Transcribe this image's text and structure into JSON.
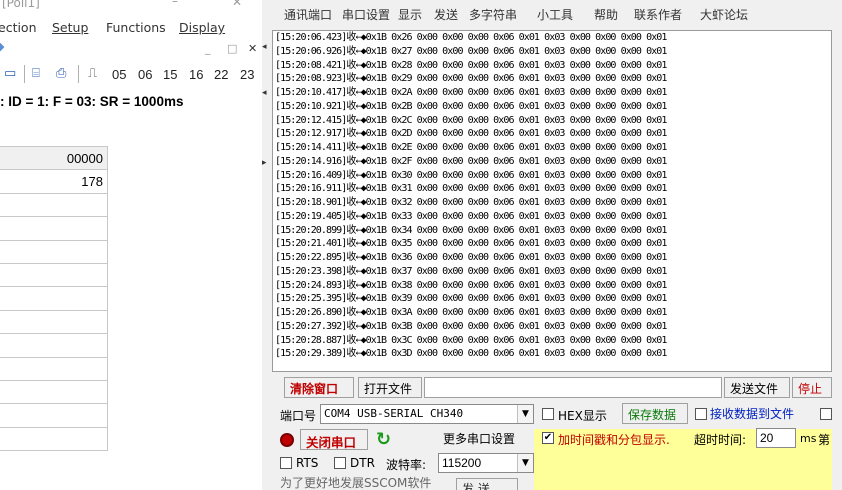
{
  "left": {
    "title_fragment": "[Poll1]",
    "title_min": "–",
    "title_close": "✕",
    "menu": [
      "ection",
      "Setup",
      "Functions",
      "Display"
    ],
    "mdi_controls": [
      "_",
      "□",
      "✕"
    ],
    "toolbar_numbers": [
      "05",
      "06",
      "15",
      "16",
      "22",
      "23"
    ],
    "status_line": ": ID = 1: F = 03: SR = 1000ms",
    "grid": {
      "header": "00000",
      "rows": [
        "178",
        "",
        "",
        "",
        "",
        "",
        "",
        "",
        "",
        "",
        "",
        ""
      ]
    }
  },
  "right": {
    "menu": [
      "通讯端口",
      "串口设置",
      "显示",
      "发送",
      "多字符串",
      "小工具",
      "帮助",
      "联系作者",
      "大虾论坛"
    ],
    "log_lines": [
      "[15:20:06.423]收←◆0x1B 0x26 0x00 0x00 0x00 0x06 0x01 0x03 0x00 0x00 0x00 0x01",
      "[15:20:06.926]收←◆0x1B 0x27 0x00 0x00 0x00 0x06 0x01 0x03 0x00 0x00 0x00 0x01",
      "[15:20:08.421]收←◆0x1B 0x28 0x00 0x00 0x00 0x06 0x01 0x03 0x00 0x00 0x00 0x01",
      "[15:20:08.923]收←◆0x1B 0x29 0x00 0x00 0x00 0x06 0x01 0x03 0x00 0x00 0x00 0x01",
      "[15:20:10.417]收←◆0x1B 0x2A 0x00 0x00 0x00 0x06 0x01 0x03 0x00 0x00 0x00 0x01",
      "[15:20:10.921]收←◆0x1B 0x2B 0x00 0x00 0x00 0x06 0x01 0x03 0x00 0x00 0x00 0x01",
      "[15:20:12.415]收←◆0x1B 0x2C 0x00 0x00 0x00 0x06 0x01 0x03 0x00 0x00 0x00 0x01",
      "[15:20:12.917]收←◆0x1B 0x2D 0x00 0x00 0x00 0x06 0x01 0x03 0x00 0x00 0x00 0x01",
      "[15:20:14.411]收←◆0x1B 0x2E 0x00 0x00 0x00 0x06 0x01 0x03 0x00 0x00 0x00 0x01",
      "[15:20:14.916]收←◆0x1B 0x2F 0x00 0x00 0x00 0x06 0x01 0x03 0x00 0x00 0x00 0x01",
      "[15:20:16.409]收←◆0x1B 0x30 0x00 0x00 0x00 0x06 0x01 0x03 0x00 0x00 0x00 0x01",
      "[15:20:16.911]收←◆0x1B 0x31 0x00 0x00 0x00 0x06 0x01 0x03 0x00 0x00 0x00 0x01",
      "[15:20:18.901]收←◆0x1B 0x32 0x00 0x00 0x00 0x06 0x01 0x03 0x00 0x00 0x00 0x01",
      "[15:20:19.405]收←◆0x1B 0x33 0x00 0x00 0x00 0x06 0x01 0x03 0x00 0x00 0x00 0x01",
      "[15:20:20.899]收←◆0x1B 0x34 0x00 0x00 0x00 0x06 0x01 0x03 0x00 0x00 0x00 0x01",
      "[15:20:21.401]收←◆0x1B 0x35 0x00 0x00 0x00 0x06 0x01 0x03 0x00 0x00 0x00 0x01",
      "[15:20:22.895]收←◆0x1B 0x36 0x00 0x00 0x00 0x06 0x01 0x03 0x00 0x00 0x00 0x01",
      "[15:20:23.398]收←◆0x1B 0x37 0x00 0x00 0x00 0x06 0x01 0x03 0x00 0x00 0x00 0x01",
      "[15:20:24.893]收←◆0x1B 0x38 0x00 0x00 0x00 0x06 0x01 0x03 0x00 0x00 0x00 0x01",
      "[15:20:25.395]收←◆0x1B 0x39 0x00 0x00 0x00 0x06 0x01 0x03 0x00 0x00 0x00 0x01",
      "[15:20:26.890]收←◆0x1B 0x3A 0x00 0x00 0x00 0x06 0x01 0x03 0x00 0x00 0x00 0x01",
      "[15:20:27.392]收←◆0x1B 0x3B 0x00 0x00 0x00 0x06 0x01 0x03 0x00 0x00 0x00 0x01",
      "[15:20:28.887]收←◆0x1B 0x3C 0x00 0x00 0x00 0x06 0x01 0x03 0x00 0x00 0x00 0x01",
      "[15:20:29.389]收←◆0x1B 0x3D 0x00 0x00 0x00 0x06 0x01 0x03 0x00 0x00 0x00 0x01"
    ],
    "clear_window": "清除窗口",
    "open_file": "打开文件",
    "send_file": "发送文件",
    "stop": "停止",
    "port_label": "端口号",
    "port_value": "COM4 USB-SERIAL CH340",
    "hex_display": "HEX显示",
    "save_data": "保存数据",
    "recv_to_file": "接收数据到文件",
    "close_port": "关闭串口",
    "more_settings": "更多串口设置",
    "timestamp_option": "加时间戳和分包显示.",
    "timeout_label": "超时时间:",
    "timeout_value": "20",
    "timeout_unit": "ms",
    "next_label": "第",
    "rts": "RTS",
    "dtr": "DTR",
    "baud_label": "波特率:",
    "baud_value": "115200",
    "footer_text": "为了更好地发展SSCOM软件",
    "send_btn": "发 送",
    "accent_red": "#c00000",
    "accent_green": "#0a7a0a",
    "highlight_yellow": "#ffff99"
  }
}
